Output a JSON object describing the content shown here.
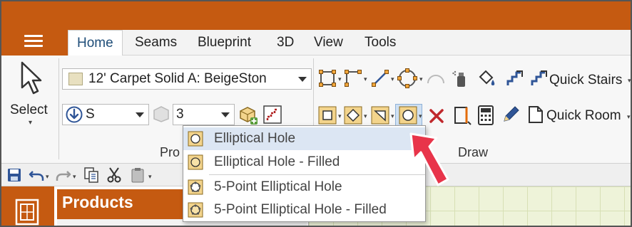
{
  "tabs": [
    {
      "label": "Home",
      "active": true
    },
    {
      "label": "Seams",
      "active": false
    },
    {
      "label": "Blueprint",
      "active": false
    },
    {
      "label": "3D",
      "active": false
    },
    {
      "label": "View",
      "active": false
    },
    {
      "label": "Tools",
      "active": false
    }
  ],
  "ribbon": {
    "select_label": "Select",
    "product_combo_value": "12' Carpet Solid A: BeigeSton",
    "direction_combo_value": "S",
    "number_combo_value": "3",
    "products_group_label": "Pro",
    "draw_group_label": "Draw",
    "quick_stairs_label": "Quick Stairs",
    "quick_room_label": "Quick Room"
  },
  "dropdown": {
    "items": [
      {
        "label": "Elliptical Hole",
        "highlighted": true
      },
      {
        "label": "Elliptical Hole - Filled",
        "highlighted": false
      },
      {
        "label": "5-Point Elliptical Hole",
        "highlighted": false
      },
      {
        "label": "5-Point Elliptical Hole - Filled",
        "highlighted": false
      }
    ]
  },
  "panel": {
    "products_title": "Products"
  },
  "colors": {
    "accent": "#c55a11",
    "tab_active_text": "#1f4e79",
    "highlight": "#dce6f3",
    "arrow": "#e8344a"
  }
}
